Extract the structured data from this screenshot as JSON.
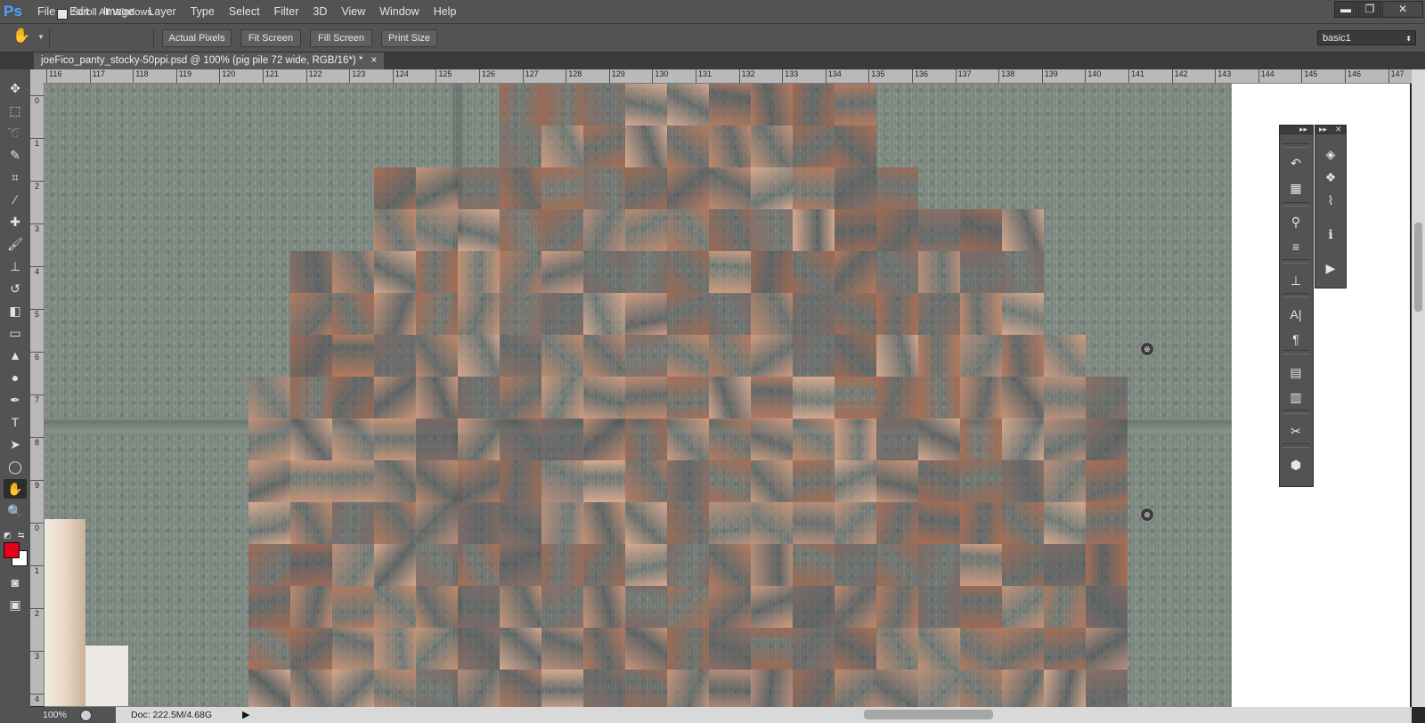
{
  "app": {
    "logo": "Ps"
  },
  "menu": [
    "File",
    "Edit",
    "Image",
    "Layer",
    "Type",
    "Select",
    "Filter",
    "3D",
    "View",
    "Window",
    "Help"
  ],
  "window_controls": {
    "minimize": "▬",
    "restore": "❐",
    "close": "✕"
  },
  "options_bar": {
    "scroll_all_windows": "Scroll All Windows",
    "actual_pixels": "Actual Pixels",
    "fit_screen": "Fit Screen",
    "fill_screen": "Fill Screen",
    "print_size": "Print Size",
    "workspace_preset": "basic1"
  },
  "document_tab": {
    "title": "joeFico_panty_stocky-50ppi.psd @ 100% (pig pile 72 wide, RGB/16*) *",
    "close": "×"
  },
  "ruler_top": [
    "116",
    "117",
    "118",
    "119",
    "120",
    "121",
    "122",
    "123",
    "124",
    "125",
    "126",
    "127",
    "128",
    "129",
    "130",
    "131",
    "132",
    "133",
    "134",
    "135",
    "136",
    "137",
    "138",
    "139",
    "140",
    "141",
    "142",
    "143",
    "144",
    "145",
    "146",
    "147"
  ],
  "ruler_left": [
    "0",
    "1",
    "2",
    "3",
    "4",
    "5",
    "6",
    "7",
    "8",
    "9",
    "0",
    "1",
    "2",
    "3",
    "4"
  ],
  "status_bar": {
    "zoom": "100%",
    "doc": "Doc: 222.5M/4.68G",
    "arrow": "▶"
  },
  "tools": [
    {
      "name": "move-tool-icon",
      "glyph": "✥"
    },
    {
      "name": "marquee-tool-icon",
      "glyph": "⬚"
    },
    {
      "name": "lasso-tool-icon",
      "glyph": "➰"
    },
    {
      "name": "quick-select-tool-icon",
      "glyph": "✎"
    },
    {
      "name": "crop-tool-icon",
      "glyph": "⌗"
    },
    {
      "name": "eyedropper-tool-icon",
      "glyph": "⁄"
    },
    {
      "name": "healing-brush-tool-icon",
      "glyph": "✚"
    },
    {
      "name": "brush-tool-icon",
      "glyph": "🖌"
    },
    {
      "name": "clone-stamp-tool-icon",
      "glyph": "⊥"
    },
    {
      "name": "history-brush-tool-icon",
      "glyph": "↺"
    },
    {
      "name": "eraser-tool-icon",
      "glyph": "◧"
    },
    {
      "name": "gradient-tool-icon",
      "glyph": "▭"
    },
    {
      "name": "blur-tool-icon",
      "glyph": "▲"
    },
    {
      "name": "dodge-tool-icon",
      "glyph": "●"
    },
    {
      "name": "pen-tool-icon",
      "glyph": "✒"
    },
    {
      "name": "type-tool-icon",
      "glyph": "T"
    },
    {
      "name": "path-select-tool-icon",
      "glyph": "➤"
    },
    {
      "name": "ellipse-tool-icon",
      "glyph": "◯"
    },
    {
      "name": "hand-tool-icon",
      "glyph": "✋"
    },
    {
      "name": "zoom-tool-icon",
      "glyph": "🔍"
    }
  ],
  "colors": {
    "foreground": "#e3001b",
    "background": "#ffffff",
    "ui_dark": "#535353",
    "pavement": "#7e8982"
  },
  "panel_left_icons": [
    {
      "name": "history-panel-icon",
      "glyph": "↶"
    },
    {
      "name": "properties-panel-icon",
      "glyph": "▦"
    },
    {
      "name": "brush-panel-icon",
      "glyph": "⚲"
    },
    {
      "name": "brush-presets-panel-icon",
      "glyph": "≡"
    },
    {
      "name": "clone-source-panel-icon",
      "glyph": "⊥"
    },
    {
      "name": "character-panel-icon",
      "glyph": "A|"
    },
    {
      "name": "paragraph-panel-icon",
      "glyph": "¶"
    },
    {
      "name": "character-styles-panel-icon",
      "glyph": "▤"
    },
    {
      "name": "paragraph-styles-panel-icon",
      "glyph": "▥"
    },
    {
      "name": "tool-presets-panel-icon",
      "glyph": "✂"
    },
    {
      "name": "3d-panel-icon",
      "glyph": "⬢"
    }
  ],
  "panel_right_icons": [
    {
      "name": "layers-panel-icon",
      "glyph": "◈"
    },
    {
      "name": "channels-panel-icon",
      "glyph": "❖"
    },
    {
      "name": "paths-panel-icon",
      "glyph": "⌇"
    },
    {
      "name": "info-panel-icon",
      "glyph": "ℹ"
    },
    {
      "name": "actions-panel-icon",
      "glyph": "▶"
    }
  ],
  "panel_controls": {
    "collapse": "▸▸",
    "close": "✕"
  }
}
